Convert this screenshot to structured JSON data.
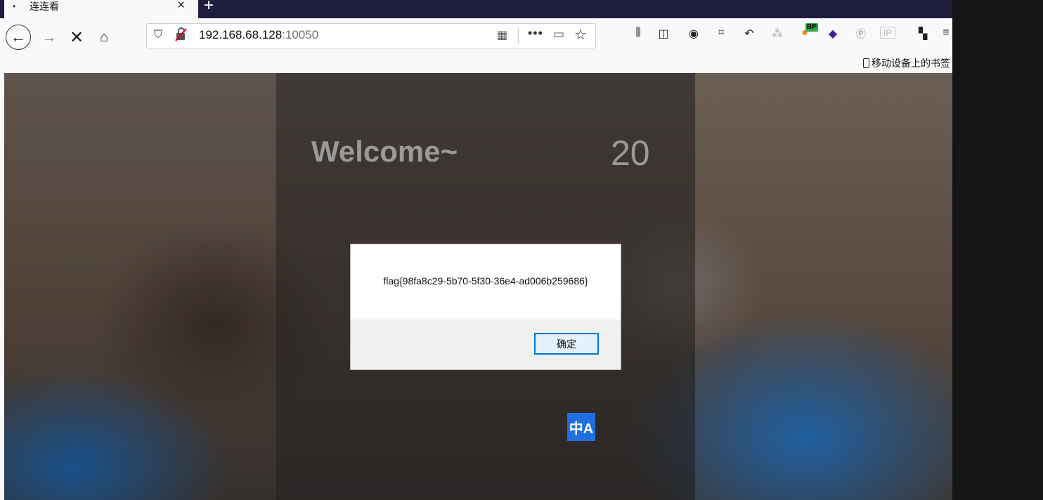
{
  "browser": {
    "tab": {
      "dot": "•",
      "title": "连连看",
      "close": "×"
    },
    "new_tab": "+",
    "nav": {
      "back": "←",
      "forward": "→",
      "stop": "✕",
      "home": "⌂"
    },
    "url": {
      "host": "192.168.68.128",
      "port": ":10050"
    },
    "url_icons": {
      "shield": "⛉",
      "insecure_lock": "🔓",
      "qr": "▦",
      "more": "•••",
      "save": "▭",
      "bookmark_star": "☆"
    },
    "toolbar": [
      {
        "name": "library-icon",
        "glyph": "⫼"
      },
      {
        "name": "sidebar-icon",
        "glyph": "◫"
      },
      {
        "name": "account-icon",
        "glyph": "◉"
      },
      {
        "name": "screenshot-icon",
        "glyph": "⌗"
      },
      {
        "name": "undo-icon",
        "glyph": "↶"
      },
      {
        "name": "extension-gray-icon",
        "glyph": "⁂"
      },
      {
        "name": "burp-proxy-icon",
        "glyph": "●"
      },
      {
        "name": "purple-diamond-icon",
        "glyph": "◆"
      },
      {
        "name": "ip-search-icon",
        "glyph": "Ⓟ"
      },
      {
        "name": "ip-icon",
        "glyph": "IP"
      },
      {
        "name": "gift-icon",
        "glyph": "▚"
      },
      {
        "name": "menu-icon",
        "glyph": "≡"
      }
    ],
    "bp_badge": "BP",
    "bookmarks_label": "移动设备上的书签"
  },
  "page": {
    "welcome": "Welcome~",
    "counter": "20",
    "translate_icon": "中A"
  },
  "dialog": {
    "message": "flag{98fa8c29-5b70-5f30-36e4-ad006b259686}",
    "ok_label": "确定"
  }
}
